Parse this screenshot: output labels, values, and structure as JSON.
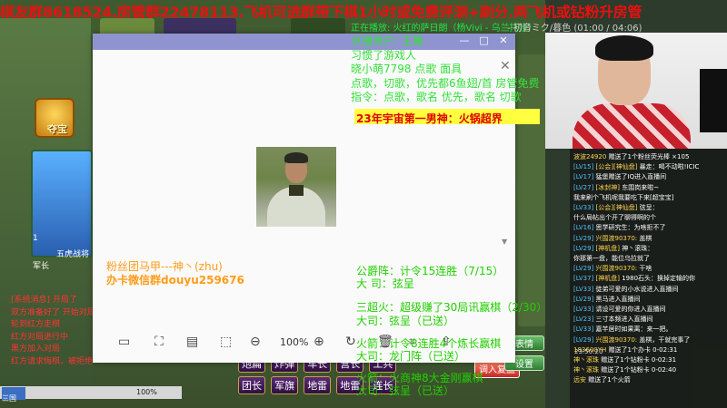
{
  "banner": "棋友群8618524.房管群22478113.飞机可进群带下棋1小时或免费评测+刷分.两飞机或钻粉升房管",
  "now_playing": "正在播放: 火红的萨日朗（杨Vivi - 乌兰托娅）",
  "now_playing_next": "- 初音ミク/暮色 (01:00 / 04:06)",
  "overlay_lines": [
    "点播用户: 主播",
    "习惯了游戏人",
    "晓小萌7798 点歌 面具",
    "点歌，切歌，优先都6鱼翅/首  房管免费",
    "指令：点歌，歌名      优先，歌名    切歌"
  ],
  "yellow_band": "23年宇宙第一男神：火锅超界",
  "fans": {
    "line1": "粉丝团马甲---神丶(zhu)",
    "line2": "办卡微信群douyu259676"
  },
  "rules": [
    "公爵阵：计令15连胜（7/15）",
    "大    司：弦呈",
    "三超火：超级赚了30局讯赢棋（2/30）",
    "大司：弦呈（已送）",
    "火箭：计令8连胜4个炼长赢棋",
    "大司：龙门阵（已送）",
    "火箭：火商神8大金刚赢棋",
    "大司：弦呈（已送）"
  ],
  "viewer": {
    "controls": [
      "—",
      "□",
      "✕"
    ],
    "zoom": "100%",
    "toolbar_icons": [
      "layout-icon",
      "scan-icon",
      "image-icon",
      "fit-icon",
      "zoom-out-icon",
      "zoom-in-icon",
      "rotate-icon",
      "delete-icon",
      "crop-icon",
      "share-icon"
    ]
  },
  "game": {
    "treasure_label": "夺宝",
    "avatar_level": "1",
    "avatar_name": "五虎战将",
    "avatar_rank": "军长",
    "log_lines": [
      "[系统消息] 开局了",
      "双方准备好了 开始对局",
      "轮到红方走棋",
      "红方对局进行中",
      "黑方加入对局",
      "红方请求悔棋，被拒绝"
    ],
    "buttons_row1": [
      "炮扁",
      "炸弹",
      "车长",
      "营长",
      "工兵"
    ],
    "buttons_row2": [
      "团长",
      "军旗",
      "地雷",
      "地雷",
      "连长"
    ],
    "right_buttons": [
      "表情",
      "设置"
    ],
    "tray_zoom": "100%",
    "mini_label": "三国",
    "copy_button": "调入复盘"
  },
  "chat": [
    {
      "lv": "",
      "name": "波波24920",
      "text": "赠送了1个粉丝荧光棒 ×105"
    },
    {
      "lv": "[LV15]",
      "name": "[公会][神仙盘]",
      "text": "暴走：喝不动啦!ICIC"
    },
    {
      "lv": "[LV17]",
      "name": "",
      "text": "猛堡赠送了IQ进入直播间"
    },
    {
      "lv": "[LV27]",
      "name": "[冰封神]",
      "text": "东围岗来啦~"
    },
    {
      "lv": "",
      "name": "",
      "text": "我来刷个飞机呢我要吃下来[超宝宝]"
    },
    {
      "lv": "[LV33]",
      "name": "[公会][神仙盘]",
      "text": "弦呈："
    },
    {
      "lv": "",
      "name": "",
      "text": "什么局帖出个开了聊得啊的个"
    },
    {
      "lv": "[LV16]",
      "name": "",
      "text": "思学研究生：为啥拒不了"
    },
    {
      "lv": "[LV29]",
      "name": "兴围渡90370:",
      "text": "盖棋"
    },
    {
      "lv": "[LV29]",
      "name": "[神机盘]",
      "text": "神丶滚珠："
    },
    {
      "lv": "",
      "name": "",
      "text": "你那第一盘，能位乌拉就了"
    },
    {
      "lv": "[LV29]",
      "name": "兴围渡90370:",
      "text": "干啥"
    },
    {
      "lv": "[LV37]",
      "name": "[神机盘]",
      "text": "1980石头：换掉定输的你"
    },
    {
      "lv": "[LV33]",
      "name": "",
      "text": "徒弟可爱的小水说进入直播间"
    },
    {
      "lv": "[LV29]",
      "name": "",
      "text": "黑马进入直播间"
    },
    {
      "lv": "[LV33]",
      "name": "",
      "text": "请设可爱的你进入直播间"
    },
    {
      "lv": "[LV23]",
      "name": "",
      "text": "三寸本频进入直播间"
    },
    {
      "lv": "[LV33]",
      "name": "",
      "text": "嘉芊居时如果离：来一把。"
    },
    {
      "lv": "[LV29]",
      "name": "兴围渡90370:",
      "text": "盖棋，干就完事了"
    },
    {
      "lv": "",
      "name": "183600YH",
      "text": "赠送了1个办卡 0-02:31"
    },
    {
      "lv": "",
      "name": "神丶滚珠",
      "text": "赠送了1个钻粉卡 0-02:31"
    },
    {
      "lv": "",
      "name": "神丶滚珠",
      "text": "赠送了1个钻粉卡 0-02:40"
    },
    {
      "lv": "",
      "name": "远安",
      "text": "赠送了1个火箭"
    }
  ],
  "chat_time": "23:50:20"
}
